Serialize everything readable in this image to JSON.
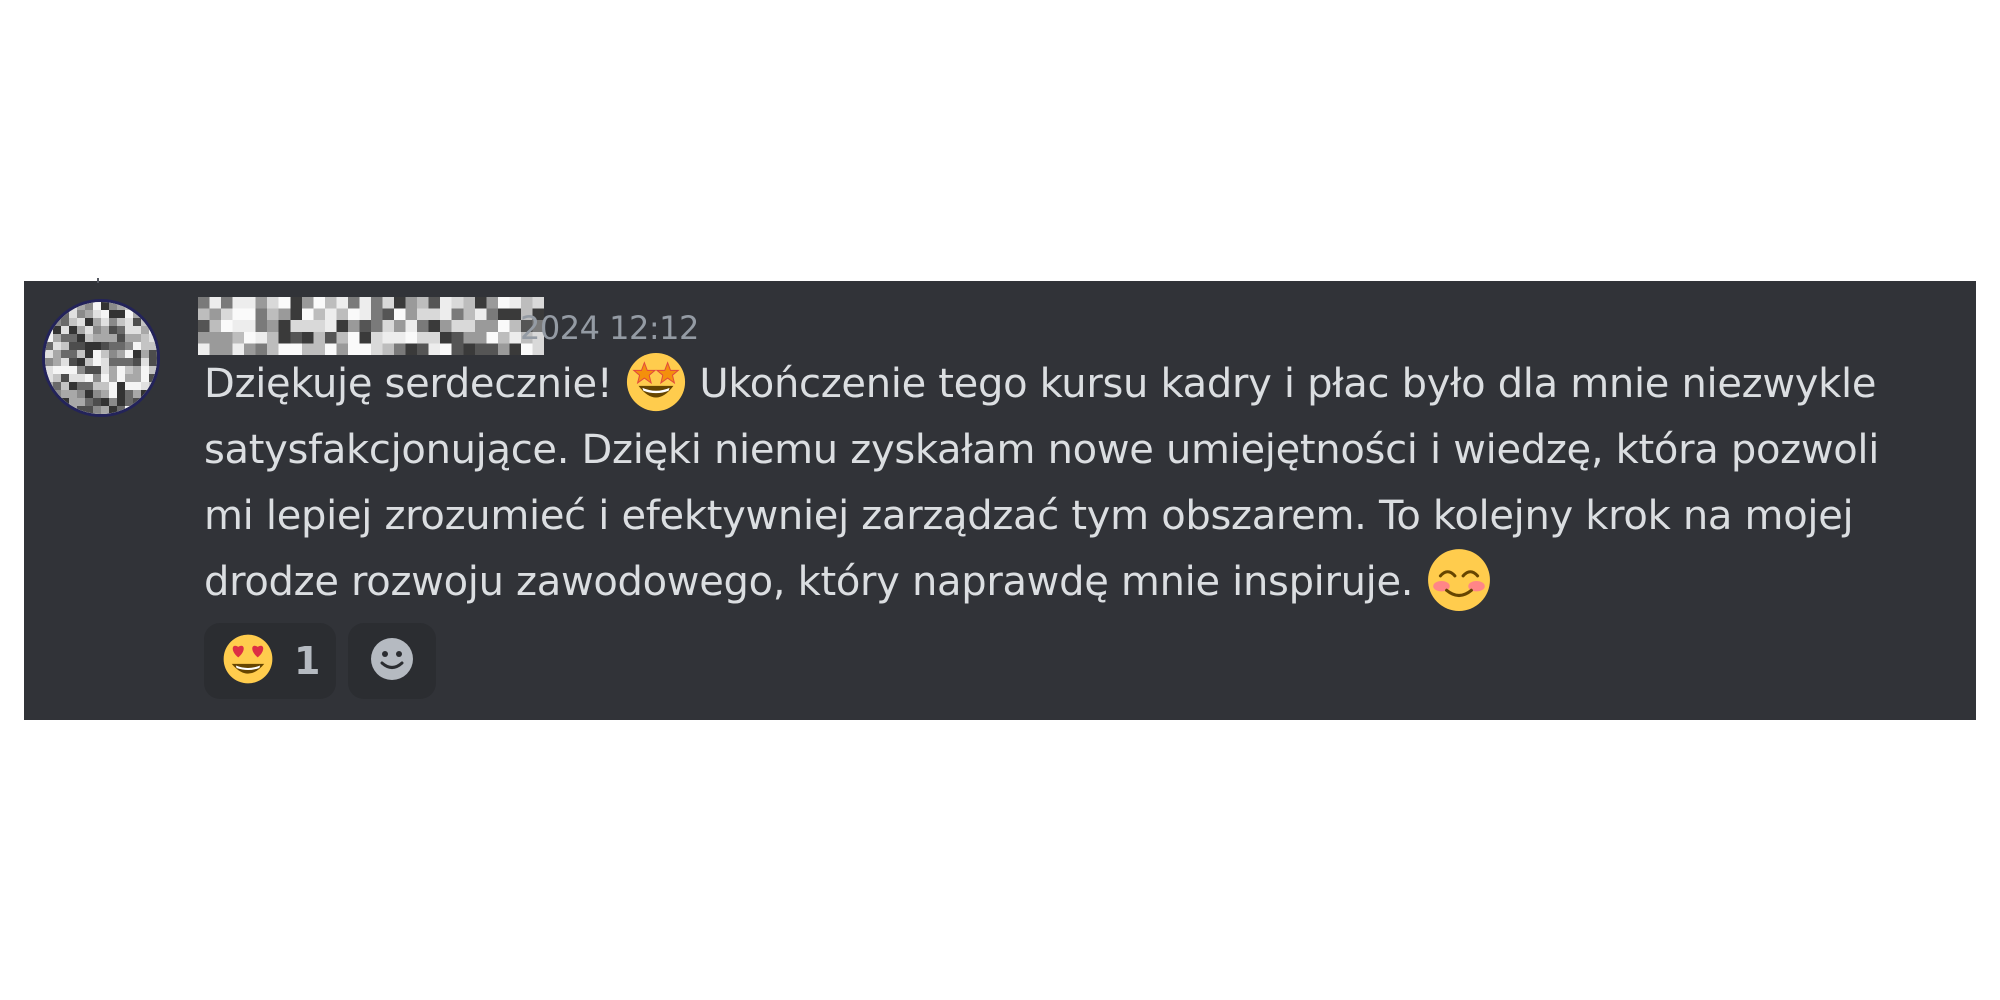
{
  "message": {
    "timestamp": "2024 12:12",
    "lines": [
      {
        "before": "Dziękuję serdecznie! ",
        "emoji": "star-struck-icon",
        "after": " Ukończenie tego kursu kadry i płac było dla mnie niezwykle"
      },
      {
        "before": "satysfakcjonujące. Dzięki niemu zyskałam nowe umiejętności i wiedzę, która pozwoli",
        "emoji": "",
        "after": ""
      },
      {
        "before": "mi lepiej zrozumieć i efektywniej zarządzać tym obszarem. To kolejny krok na mojej",
        "emoji": "",
        "after": ""
      },
      {
        "before": "drodze rozwoju zawodowego, który naprawdę mnie inspiruje. ",
        "emoji": "smiling-blush-icon",
        "after": ""
      }
    ]
  },
  "reactions": [
    {
      "emoji": "heart-eyes-icon",
      "count": "1"
    }
  ],
  "add_reaction": {
    "icon": "add-reaction-smiley-icon"
  },
  "colors": {
    "card_background": "#313338",
    "text": "#dbdee1",
    "timestamp": "#949ba4",
    "reaction_background": "#2b2d31"
  }
}
